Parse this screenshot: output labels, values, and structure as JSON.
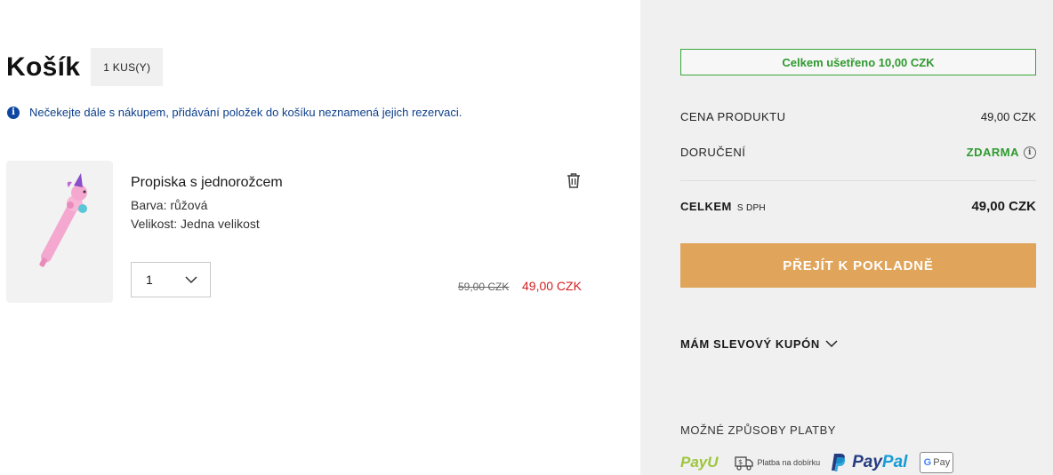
{
  "cart": {
    "title": "Košík",
    "count_badge": "1 KUS(Y)",
    "notice": "Nečekejte dále s nákupem, přidávání položek do košíku neznamená jejich rezervaci.",
    "items": [
      {
        "name": "Propiska s jednorožcem",
        "color_line": "Barva: růžová",
        "size_line": "Velikost: Jedna velikost",
        "quantity": "1",
        "price_old": "59,00 CZK",
        "price_new": "49,00 CZK",
        "image_icon": "unicorn-pen-image"
      }
    ]
  },
  "summary": {
    "saved": "Celkem ušetřeno 10,00 CZK",
    "product_price_label": "CENA PRODUKTU",
    "product_price_value": "49,00 CZK",
    "delivery_label": "DORUČENÍ",
    "delivery_value": "ZDARMA",
    "total_label": "CELKEM",
    "total_sub": "S DPH",
    "total_value": "49,00 CZK",
    "checkout_label": "PŘEJÍT K POKLADNĚ",
    "coupon_label": "MÁM SLEVOVÝ KUPÓN",
    "payment_title": "MOŽNÉ ZPŮSOBY PLATBY",
    "payments": {
      "payu": "PayU",
      "cod": "Platba na dobírku",
      "paypal_a": "Pay",
      "paypal_b": "Pal",
      "gpay_g": "G",
      "gpay_text": "Pay"
    }
  },
  "colors": {
    "accent_checkout": "#e0a45a",
    "saved_green": "#2e9a2e",
    "sale_red": "#d32020",
    "info_blue": "#0d47a1"
  }
}
